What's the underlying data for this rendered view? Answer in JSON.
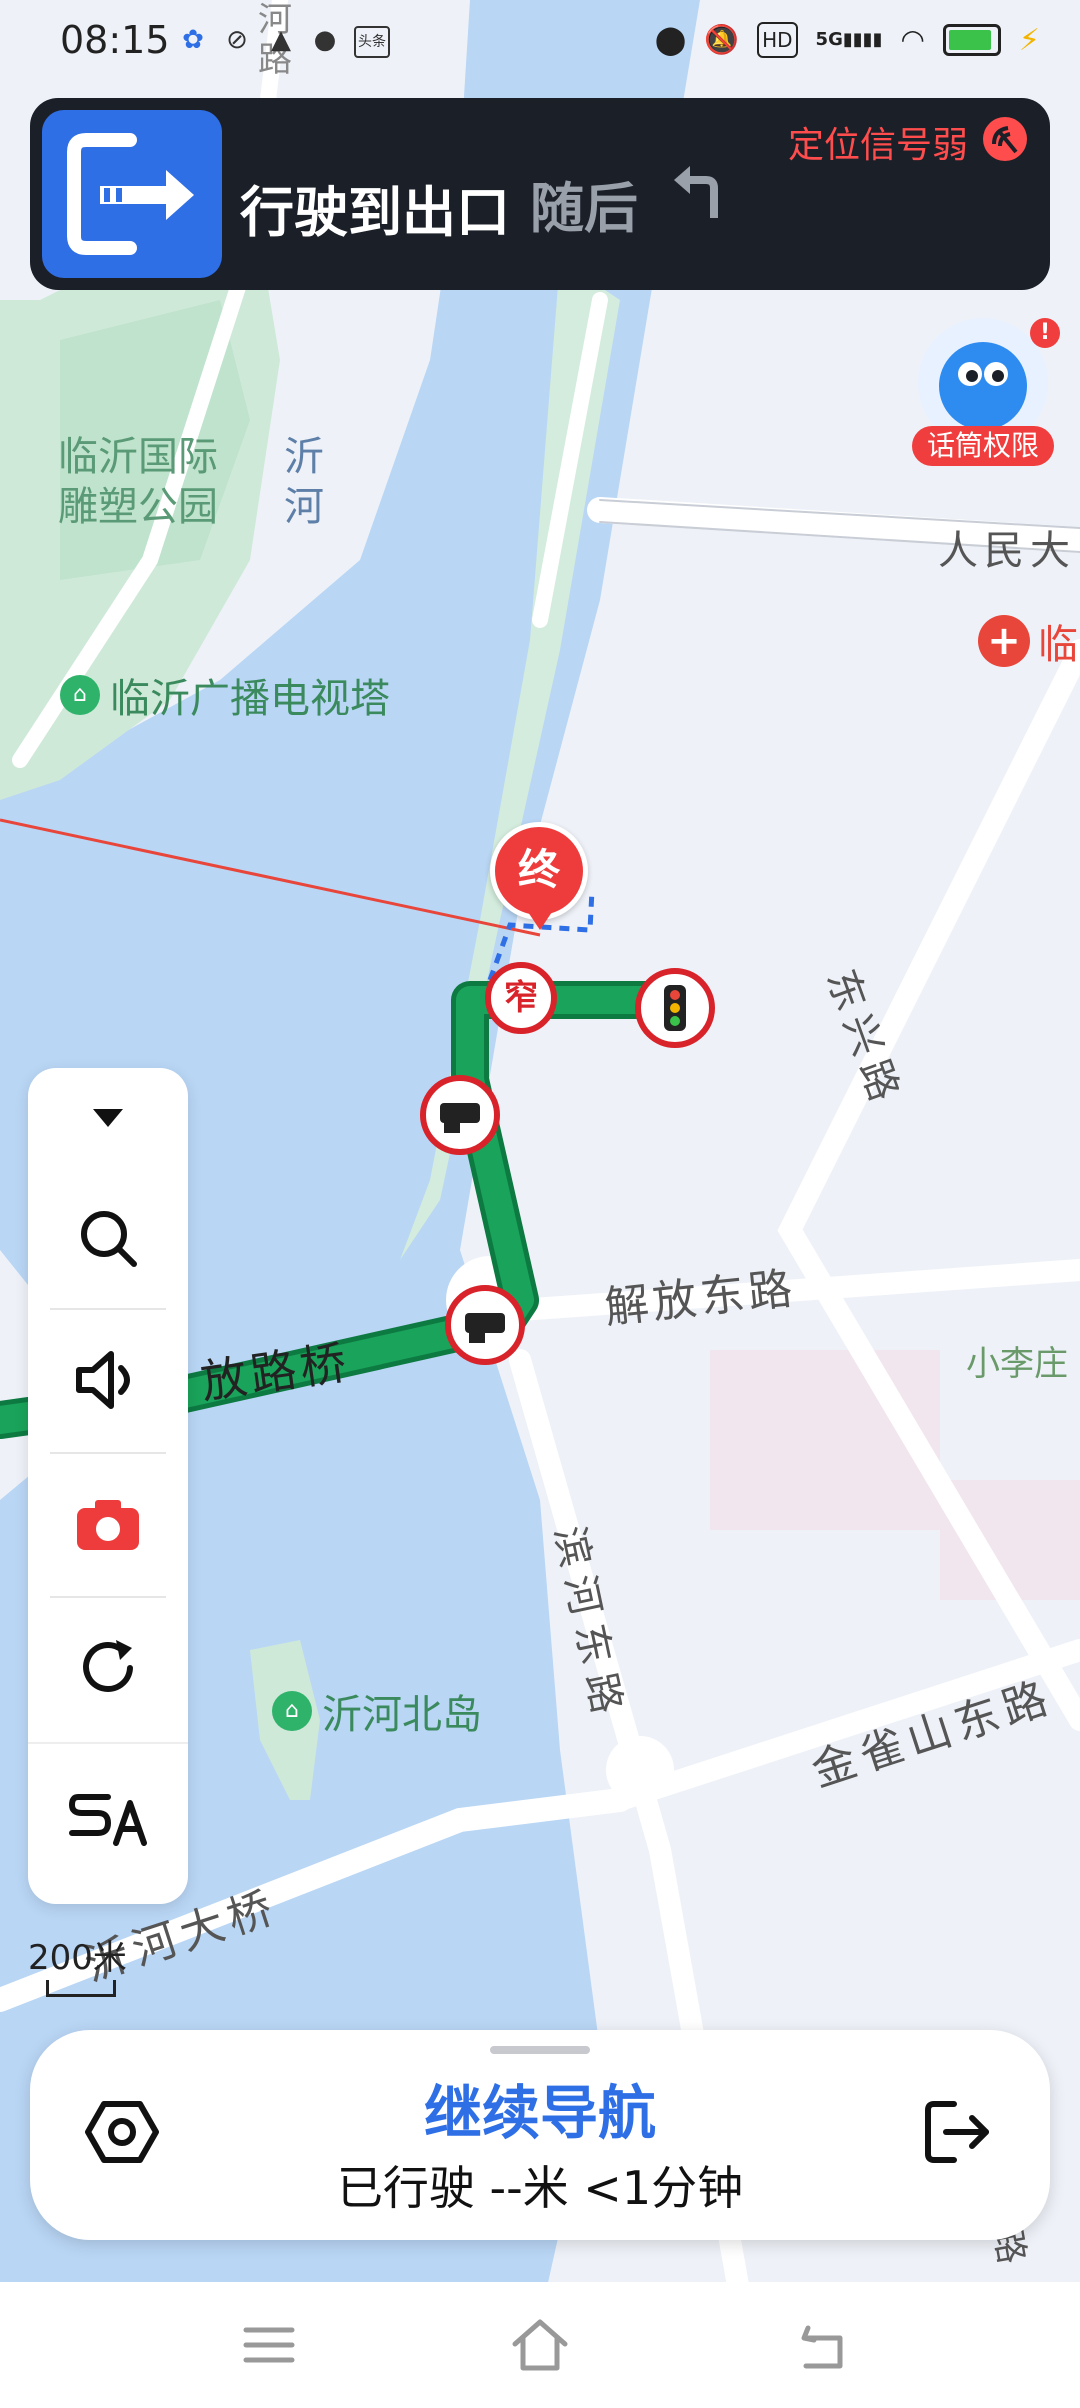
{
  "status_bar": {
    "time": "08:15",
    "left_icons": [
      "baidu-icon",
      "sync-icon",
      "store-icon",
      "chat-icon",
      "toutiao-icon"
    ],
    "toutiao_label": "头条",
    "right_icons": [
      "location-icon",
      "mute-icon",
      "hd-icon",
      "5g-signal-icon",
      "wifi-icon",
      "battery-icon",
      "charging-icon"
    ],
    "hd_label": "HD",
    "network_label": "5G"
  },
  "nav_banner": {
    "instruction": "行驶到出口",
    "next_label": "随后",
    "gps_warning": "定位信号弱",
    "maneuver_icon": "exit-arrow-icon",
    "next_turn_icon": "turn-left-icon"
  },
  "assistant": {
    "badge_label": "话筒权限",
    "alert": "!"
  },
  "map_labels": {
    "park": "临沂国际\n雕塑公园",
    "river_name": "沂\n河",
    "tv_tower": "临沂广播电视塔",
    "renmin_road": "人民大",
    "hospital_partial": "临",
    "dongxing_road": "东兴路",
    "jiefang_east": "解放东路",
    "xiaolizhuang": "小李庄",
    "jiefang_bridge": "放路桥",
    "binhe_east": "滨河东路",
    "jinque_east": "金雀山东路",
    "yihe_island": "沂河北岛",
    "yihe_bridge": "沂河大桥",
    "corner_road": "祭东路",
    "top_road": "河\n路",
    "end_marker": "终",
    "narrow_marker": "窄"
  },
  "toolbar": {
    "items": [
      "collapse-icon",
      "search-icon",
      "volume-icon",
      "camera-icon",
      "refresh-icon",
      "route-preference-icon"
    ]
  },
  "scale": {
    "label": "200米"
  },
  "bottom_card": {
    "title": "继续导航",
    "subtitle": "已行驶 --米 <1分钟",
    "left_icon": "settings-hex-icon",
    "right_icon": "exit-nav-icon"
  },
  "system_nav": {
    "items": [
      "menu-icon",
      "home-icon",
      "back-icon"
    ]
  },
  "colors": {
    "route_green": "#1aa35a",
    "banner_bg": "#1b1f28",
    "maneuver_blue": "#2f6fe6",
    "warning_red": "#ff4d4d",
    "water": "#b9d6f5",
    "land": "#eef2f8",
    "park": "#c9e8d5"
  }
}
